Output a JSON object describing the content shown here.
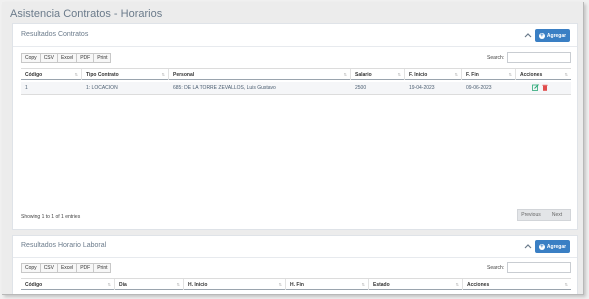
{
  "page": {
    "title": "Asistencia Contratos - Horarios"
  },
  "contracts": {
    "title": "Resultados Contratos",
    "add_label": "Agregar",
    "export_buttons": [
      "Copy",
      "CSV",
      "Excel",
      "PDF",
      "Print"
    ],
    "search_label": "Search:",
    "search_value": "",
    "columns": [
      "Código",
      "Tipo Contrato",
      "Personal",
      "Salario",
      "F. Inicio",
      "F. Fin",
      "Acciones"
    ],
    "rows": [
      {
        "codigo": "1",
        "tipo": "1: LOCACION",
        "personal": "685: DE LA TORRE ZEVALLOS, Luis Gustavo",
        "salario": "2500",
        "inicio": "19-04-2023",
        "fin": "09-06-2023"
      }
    ],
    "info": "Showing 1 to 1 of 1 entries",
    "pager": {
      "previous": "Previous",
      "next": "Next"
    }
  },
  "schedule": {
    "title": "Resultados Horario Laboral",
    "add_label": "Agregar",
    "export_buttons": [
      "Copy",
      "CSV",
      "Excel",
      "PDF",
      "Print"
    ],
    "search_label": "Search:",
    "search_value": "",
    "columns": [
      "Código",
      "Día",
      "H. Inicio",
      "H. Fin",
      "Estado",
      "Acciones"
    ]
  },
  "colors": {
    "accent": "#3a7fc4",
    "edit": "#2aa876",
    "delete": "#e04b4b"
  },
  "icons": {
    "collapse": "chevron-up-icon",
    "add": "plus-circle-icon",
    "edit": "edit-icon",
    "delete": "trash-icon",
    "sort": "sort-icon"
  }
}
